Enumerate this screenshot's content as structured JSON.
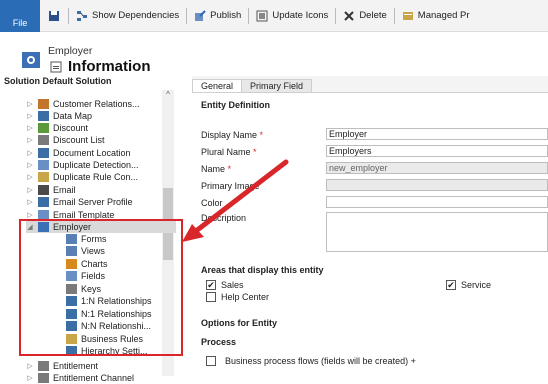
{
  "toolbar": {
    "file_label": "File",
    "show_dependencies": "Show Dependencies",
    "publish": "Publish",
    "update_icons": "Update Icons",
    "delete": "Delete",
    "managed_properties": "Managed Pr"
  },
  "header": {
    "entity": "Employer",
    "title": "Information"
  },
  "nav": {
    "solution_title": "Solution Default Solution",
    "items": [
      {
        "label": "Customer Relations...",
        "icon": "people-icon"
      },
      {
        "label": "Data Map",
        "icon": "map-icon"
      },
      {
        "label": "Discount",
        "icon": "discount-icon"
      },
      {
        "label": "Discount List",
        "icon": "list-icon"
      },
      {
        "label": "Document Location",
        "icon": "location-icon"
      },
      {
        "label": "Duplicate Detection...",
        "icon": "duplicate-icon"
      },
      {
        "label": "Duplicate Rule Con...",
        "icon": "rule-icon"
      },
      {
        "label": "Email",
        "icon": "email-icon"
      },
      {
        "label": "Email Server Profile",
        "icon": "server-icon"
      },
      {
        "label": "Email Template",
        "icon": "template-icon"
      },
      {
        "label": "Employer",
        "icon": "entity-icon"
      },
      {
        "label": "Forms",
        "icon": "form-icon"
      },
      {
        "label": "Views",
        "icon": "view-icon"
      },
      {
        "label": "Charts",
        "icon": "chart-icon"
      },
      {
        "label": "Fields",
        "icon": "field-icon"
      },
      {
        "label": "Keys",
        "icon": "key-icon"
      },
      {
        "label": "1:N Relationships",
        "icon": "relationship-icon"
      },
      {
        "label": "N:1 Relationships",
        "icon": "relationship-icon"
      },
      {
        "label": "N:N Relationshi...",
        "icon": "relationship-icon"
      },
      {
        "label": "Business Rules",
        "icon": "rules-icon"
      },
      {
        "label": "Hierarchy Setti...",
        "icon": "hierarchy-icon"
      },
      {
        "label": "Entitlement",
        "icon": "entitlement-icon"
      },
      {
        "label": "Entitlement Channel",
        "icon": "channel-icon"
      }
    ]
  },
  "tabs": [
    "General",
    "Primary Field"
  ],
  "form": {
    "entity_definition": "Entity Definition",
    "display_name_label": "Display Name",
    "display_name_value": "Employer",
    "plural_name_label": "Plural Name",
    "plural_name_value": "Employers",
    "name_label": "Name",
    "name_value": "new_employer",
    "primary_image_label": "Primary Image",
    "color_label": "Color",
    "description_label": "Description",
    "areas_title": "Areas that display this entity",
    "sales_label": "Sales",
    "service_label": "Service",
    "help_center_label": "Help Center",
    "options_title": "Options for Entity",
    "process_title": "Process",
    "bpf_label": "Business process flows (fields will be created) +",
    "required_mark": "*"
  },
  "colors": {
    "accent": "#2b6cb7",
    "highlight_box": "#d9262b",
    "arrow": "#d9262b"
  }
}
